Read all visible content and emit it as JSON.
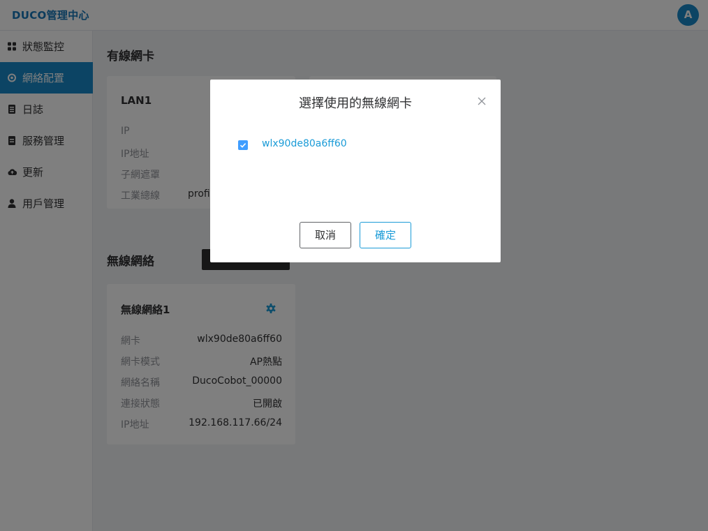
{
  "app": {
    "brand": "DUCO管理中心",
    "avatar_letter": "A"
  },
  "sidebar": {
    "items": [
      {
        "label": "狀態監控",
        "icon": "dashboard-icon"
      },
      {
        "label": "網絡配置",
        "icon": "network-icon",
        "active": true
      },
      {
        "label": "日誌",
        "icon": "log-icon"
      },
      {
        "label": "服務管理",
        "icon": "service-icon"
      },
      {
        "label": "更新",
        "icon": "cloud-icon"
      },
      {
        "label": "用戶管理",
        "icon": "user-icon"
      }
    ]
  },
  "wired": {
    "title": "有線網卡",
    "card": {
      "title": "LAN1",
      "labels": [
        "IP",
        "IP地址",
        "子網遮罩",
        "工業總線"
      ],
      "industrial_bus_value": "profi"
    }
  },
  "wireless": {
    "title": "無線網絡",
    "card": {
      "title": "無線網絡1",
      "rows": [
        {
          "label": "網卡",
          "value": "wlx90de80a6ff60"
        },
        {
          "label": "網卡模式",
          "value": "AP熱點"
        },
        {
          "label": "網絡名稱",
          "value": "DucoCobot_00000"
        },
        {
          "label": "連接狀態",
          "value": "已開啟"
        },
        {
          "label": "IP地址",
          "value": "192.168.117.66/24"
        }
      ]
    }
  },
  "dialog": {
    "title": "選擇使用的無線網卡",
    "option": {
      "label": "wlx90de80a6ff60",
      "checked": true
    },
    "cancel_label": "取消",
    "confirm_label": "確定"
  },
  "colors": {
    "accent": "#1989c9",
    "link": "#1a9bd7",
    "checkbox": "#409eff",
    "overlay": "rgba(0,0,0,0.5)"
  }
}
